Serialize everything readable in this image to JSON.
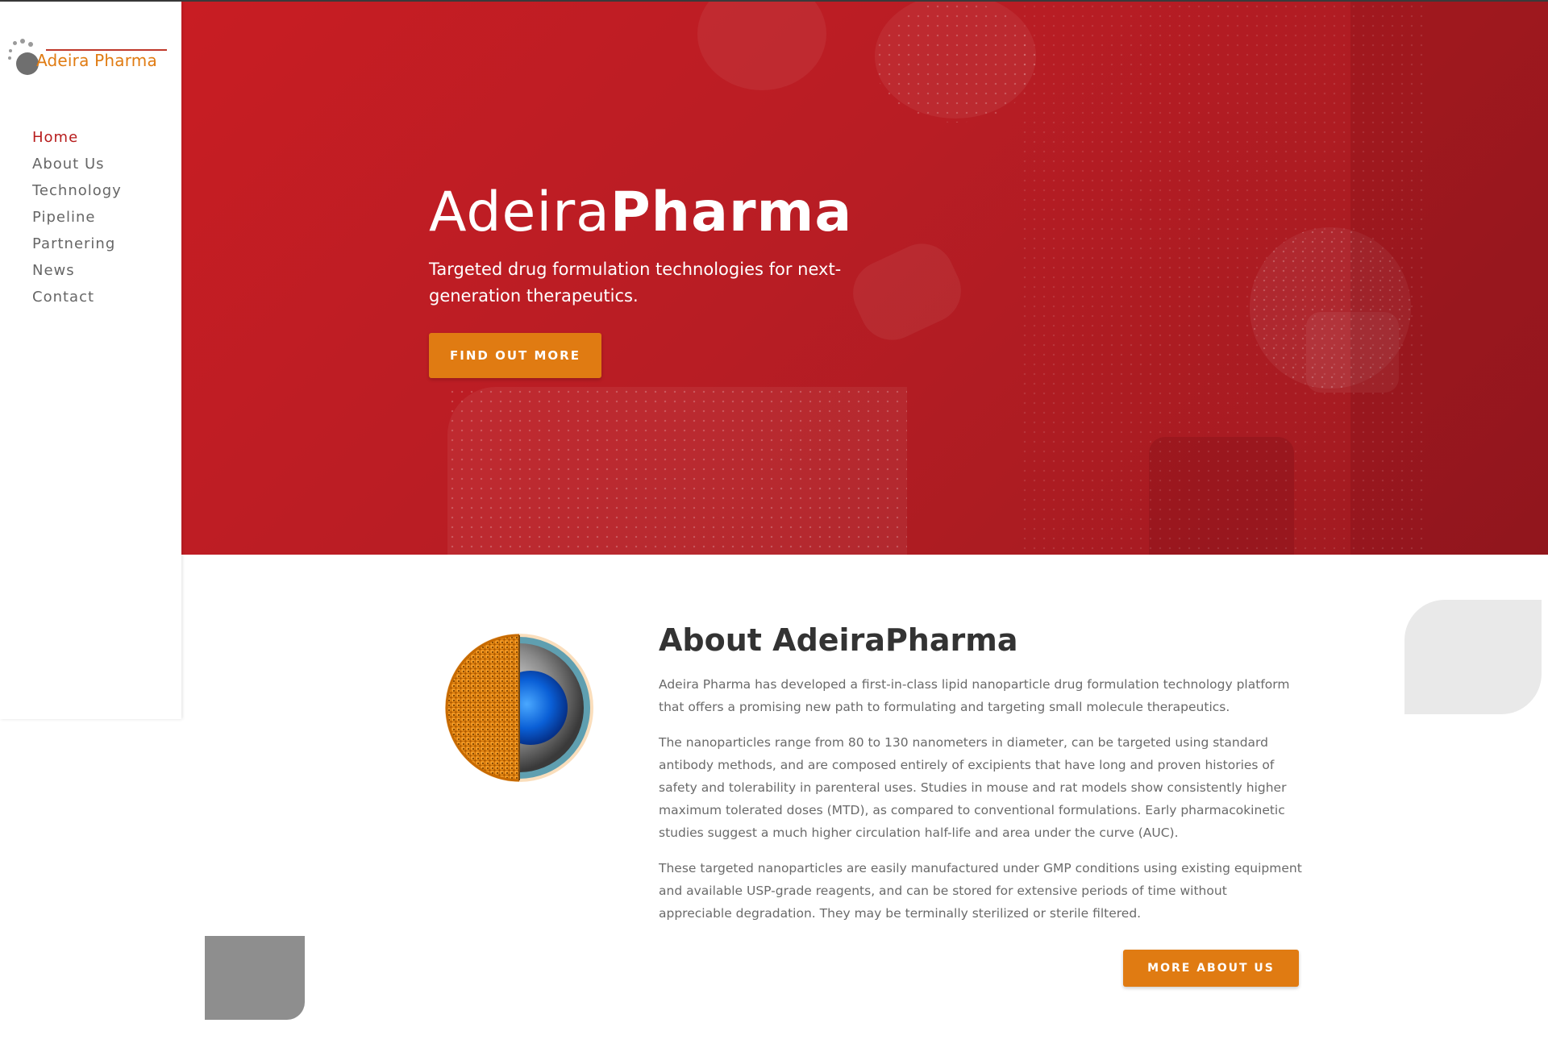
{
  "logo": {
    "text": "Adeira Pharma"
  },
  "nav": {
    "items": [
      {
        "label": "Home",
        "active": true
      },
      {
        "label": "About Us",
        "active": false
      },
      {
        "label": "Technology",
        "active": false
      },
      {
        "label": "Pipeline",
        "active": false
      },
      {
        "label": "Partnering",
        "active": false
      },
      {
        "label": "News",
        "active": false
      },
      {
        "label": "Contact",
        "active": false
      }
    ]
  },
  "hero": {
    "title_light": "Adeira",
    "title_bold": "Pharma",
    "subtitle": "Targeted drug formulation technologies for next-generation therapeutics.",
    "button_label": "FIND OUT MORE"
  },
  "about": {
    "title": "About AdeiraPharma",
    "paragraphs": [
      "Adeira Pharma has developed a first-in-class lipid nanoparticle drug formulation technology platform that offers a promising new path to formulating and targeting small molecule therapeutics.",
      "The nanoparticles range from 80 to 130 nanometers in diameter, can be targeted using standard antibody methods, and are composed entirely of excipients that have long and proven histories of safety and tolerability in parenteral uses. Studies in mouse and rat models show consistently higher maximum tolerated doses (MTD), as compared to conventional formulations. Early pharmacokinetic studies suggest a much higher circulation half-life and area under the curve (AUC).",
      "These targeted nanoparticles are easily manufactured under GMP conditions using existing equipment and available USP-grade reagents, and can be stored for extensive periods of time without appreciable degradation. They may be terminally sterilized or sterile filtered."
    ],
    "button_label": "MORE ABOUT US"
  },
  "colors": {
    "accent_orange": "#e07b12",
    "hero_red": "#c81d23",
    "nav_active": "#b71c1c"
  }
}
